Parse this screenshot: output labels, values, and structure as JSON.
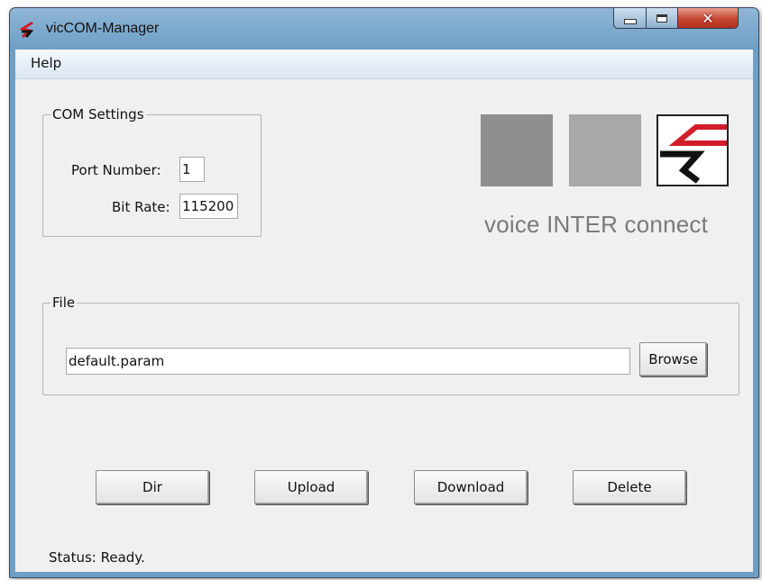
{
  "window": {
    "title": "vicCOM-Manager"
  },
  "menu": {
    "help": "Help"
  },
  "com_settings": {
    "legend": "COM Settings",
    "port_label": "Port Number:",
    "port_value": "1",
    "bitrate_label": "Bit Rate:",
    "bitrate_value": "115200"
  },
  "logo": {
    "text": "voice INTER connect"
  },
  "file": {
    "legend": "File",
    "path_value": "default.param",
    "browse_label": "Browse"
  },
  "actions": {
    "dir": "Dir",
    "upload": "Upload",
    "download": "Download",
    "delete": "Delete"
  },
  "status": {
    "text": "Status:  Ready."
  },
  "colors": {
    "logo_gray_dark": "#8e8e8e",
    "logo_gray_light": "#a9a9a9",
    "logo_red": "#d21d2a",
    "close_red": "#c54530"
  },
  "icons": {
    "app": "vic-logo-icon",
    "minimize": "minimize-icon",
    "maximize": "maximize-icon",
    "close": "close-icon"
  }
}
